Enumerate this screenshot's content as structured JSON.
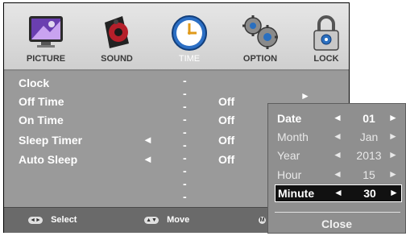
{
  "tabs": [
    {
      "label": "PICTURE",
      "icon": "monitor-icon"
    },
    {
      "label": "SOUND",
      "icon": "speaker-icon"
    },
    {
      "label": "TIME",
      "icon": "clock-icon"
    },
    {
      "label": "OPTION",
      "icon": "gears-icon"
    },
    {
      "label": "LOCK",
      "icon": "padlock-icon"
    }
  ],
  "active_tab": "TIME",
  "menu": {
    "clock": {
      "label": "Clock",
      "value": "-- -- --  -- --"
    },
    "off_time": {
      "label": "Off Time",
      "value": "Off"
    },
    "on_time": {
      "label": "On Time",
      "value": "Off"
    },
    "sleep_timer": {
      "label": "Sleep Timer",
      "value": "Off",
      "left_arrow": "◄"
    },
    "auto_sleep": {
      "label": "Auto Sleep",
      "value": "Off",
      "left_arrow": "◄"
    }
  },
  "footer": {
    "select": {
      "glyphs": "◄►",
      "label": "Select"
    },
    "move": {
      "glyphs": "▲▼",
      "label": "Move"
    },
    "menu_glyph": "M"
  },
  "popup": {
    "rows": [
      {
        "label": "Date",
        "value": "01"
      },
      {
        "label": "Month",
        "value": "Jan"
      },
      {
        "label": "Year",
        "value": "2013"
      },
      {
        "label": "Hour",
        "value": "15"
      },
      {
        "label": "Minute",
        "value": "30"
      }
    ],
    "selected_row": "Minute",
    "left_arrow": "◄",
    "right_arrow": "►",
    "close_label": "Close",
    "behind_arrow": "►"
  },
  "colors": {
    "frame_bg": "#1e1e1e",
    "content_bg": "#9a9a9a",
    "footer_bg": "#6a6a6a",
    "popup_bg": "#8f8f8f",
    "selected_bg": "#111111"
  }
}
